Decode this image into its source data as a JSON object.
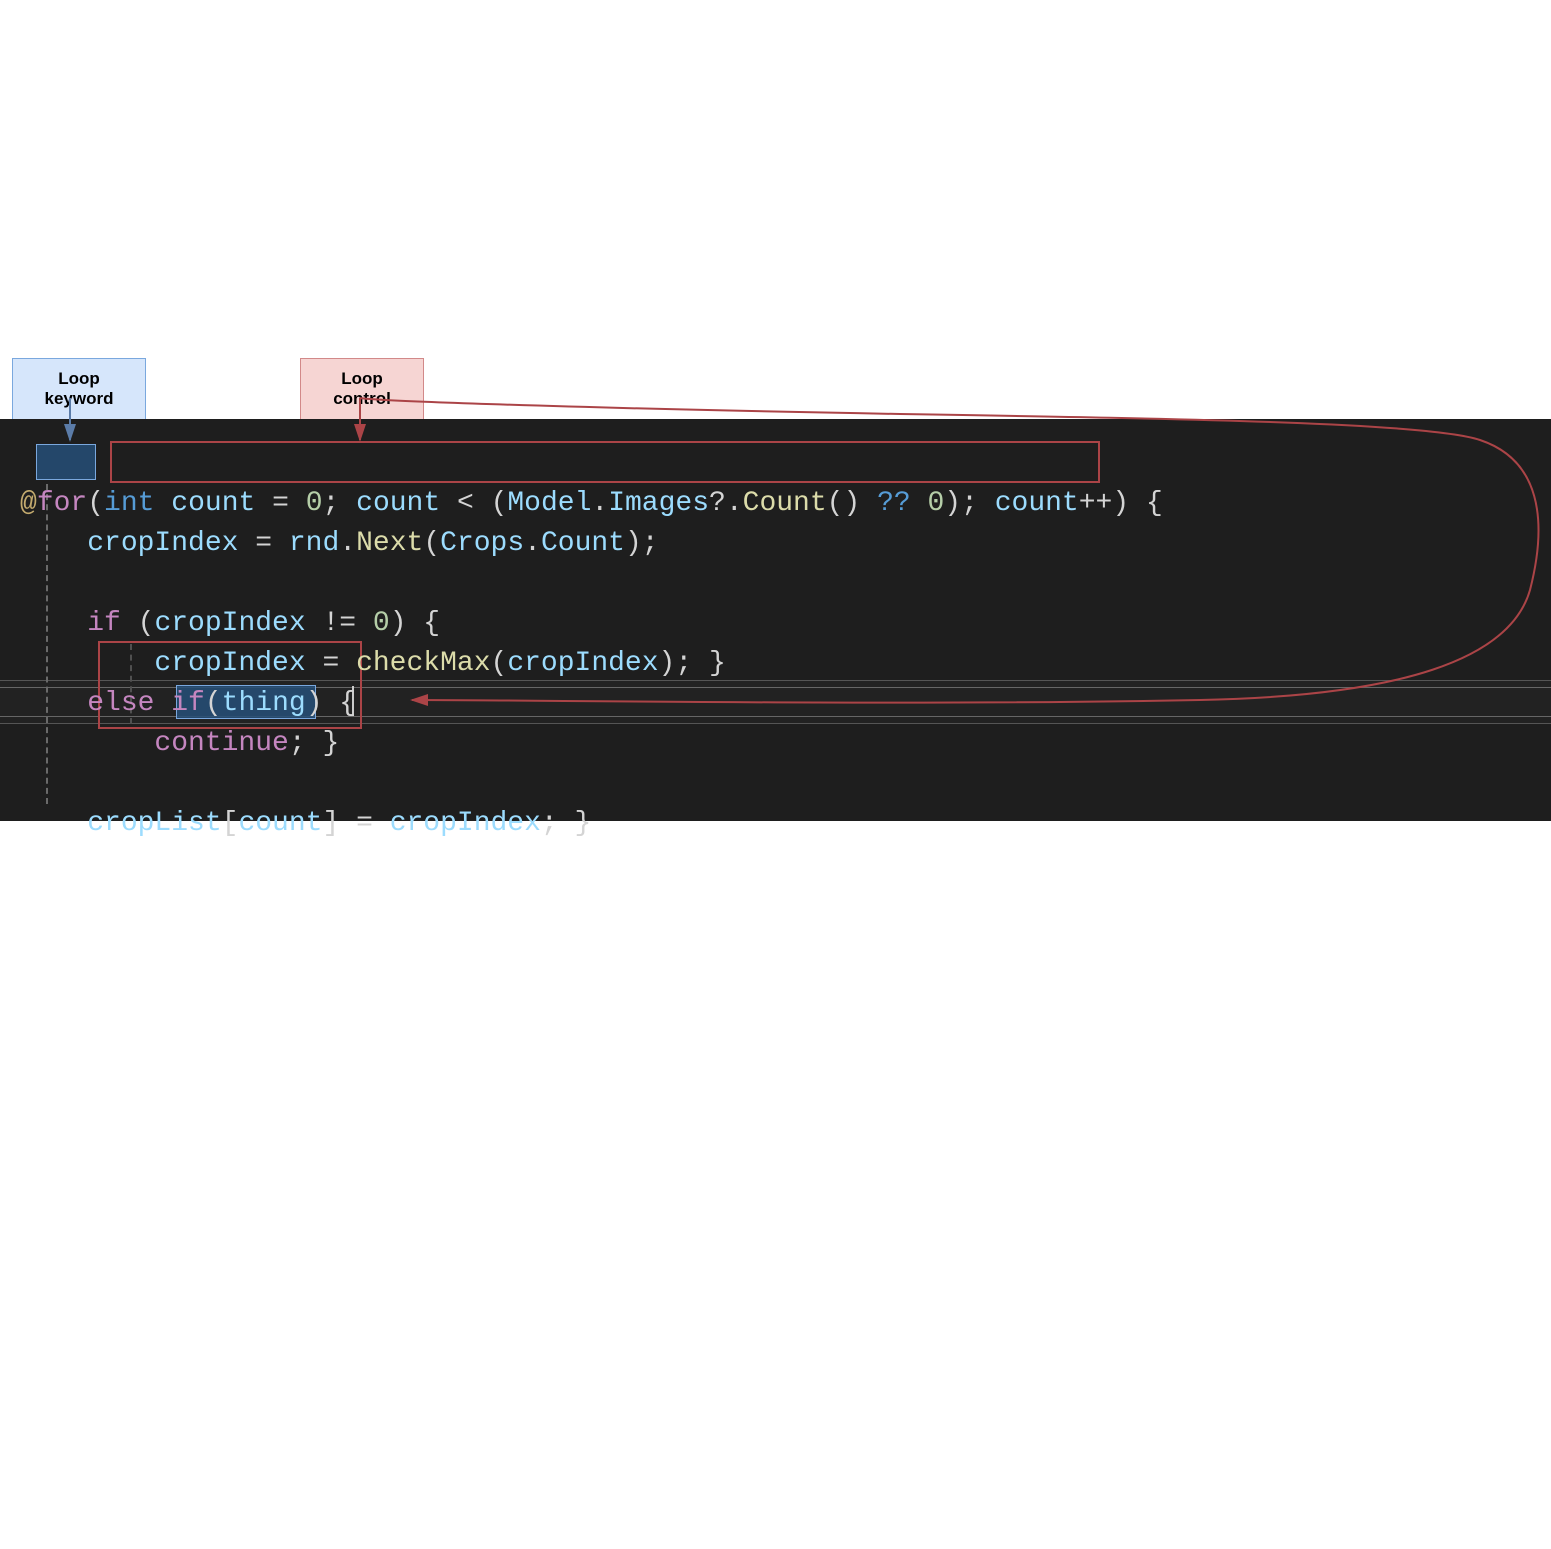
{
  "labels": {
    "loop_keyword": "Loop keyword",
    "loop_control": "Loop control"
  },
  "code": {
    "line1": {
      "razor_at": "@",
      "for_kw": "for",
      "p_open": "(",
      "int_kw": "int",
      "sp1": " ",
      "count1": "count",
      "eq": " = ",
      "zero1": "0",
      "semi1": "; ",
      "count2": "count",
      "lt": " < (",
      "model": "Model",
      "dot1": ".",
      "images": "Images",
      "qdot": "?.",
      "countfn": "Count",
      "paren_call": "()",
      "nullcoal": " ?? ",
      "zero2": "0",
      "p_close1": "); ",
      "count3": "count",
      "inc": "++",
      "p_close_main": ")",
      "brace_open_sp": " {"
    },
    "line2": {
      "indent": "    ",
      "cropIndex": "cropIndex",
      "eq": " = ",
      "rnd": "rnd",
      "dot": ".",
      "next": "Next",
      "po": "(",
      "crops": "Crops",
      "dot2": ".",
      "count": "Count",
      "pc": ");"
    },
    "line4": {
      "indent": "    ",
      "if_kw": "if",
      "sp": " (",
      "cropIndex": "cropIndex",
      "neq": " != ",
      "zero": "0",
      "pc": ") {"
    },
    "line5": {
      "indent": "        ",
      "cropIndex": "cropIndex",
      "eq": " = ",
      "checkMax": "checkMax",
      "po": "(",
      "cropIndex2": "cropIndex",
      "pc": "); }"
    },
    "line6": {
      "indent": "    ",
      "else_kw": "else",
      "sp": " ",
      "if_kw": "if",
      "po": "(",
      "thing": "thing",
      "pc": ") {"
    },
    "line7": {
      "indent": "        ",
      "continue_kw": "continue",
      "semi": "; ",
      "brace": "}"
    },
    "line9": {
      "indent": "    ",
      "cropList": "cropList",
      "bo": "[",
      "count": "count",
      "bc": "] = ",
      "cropIndex": "cropIndex",
      "semi": "; }"
    }
  }
}
